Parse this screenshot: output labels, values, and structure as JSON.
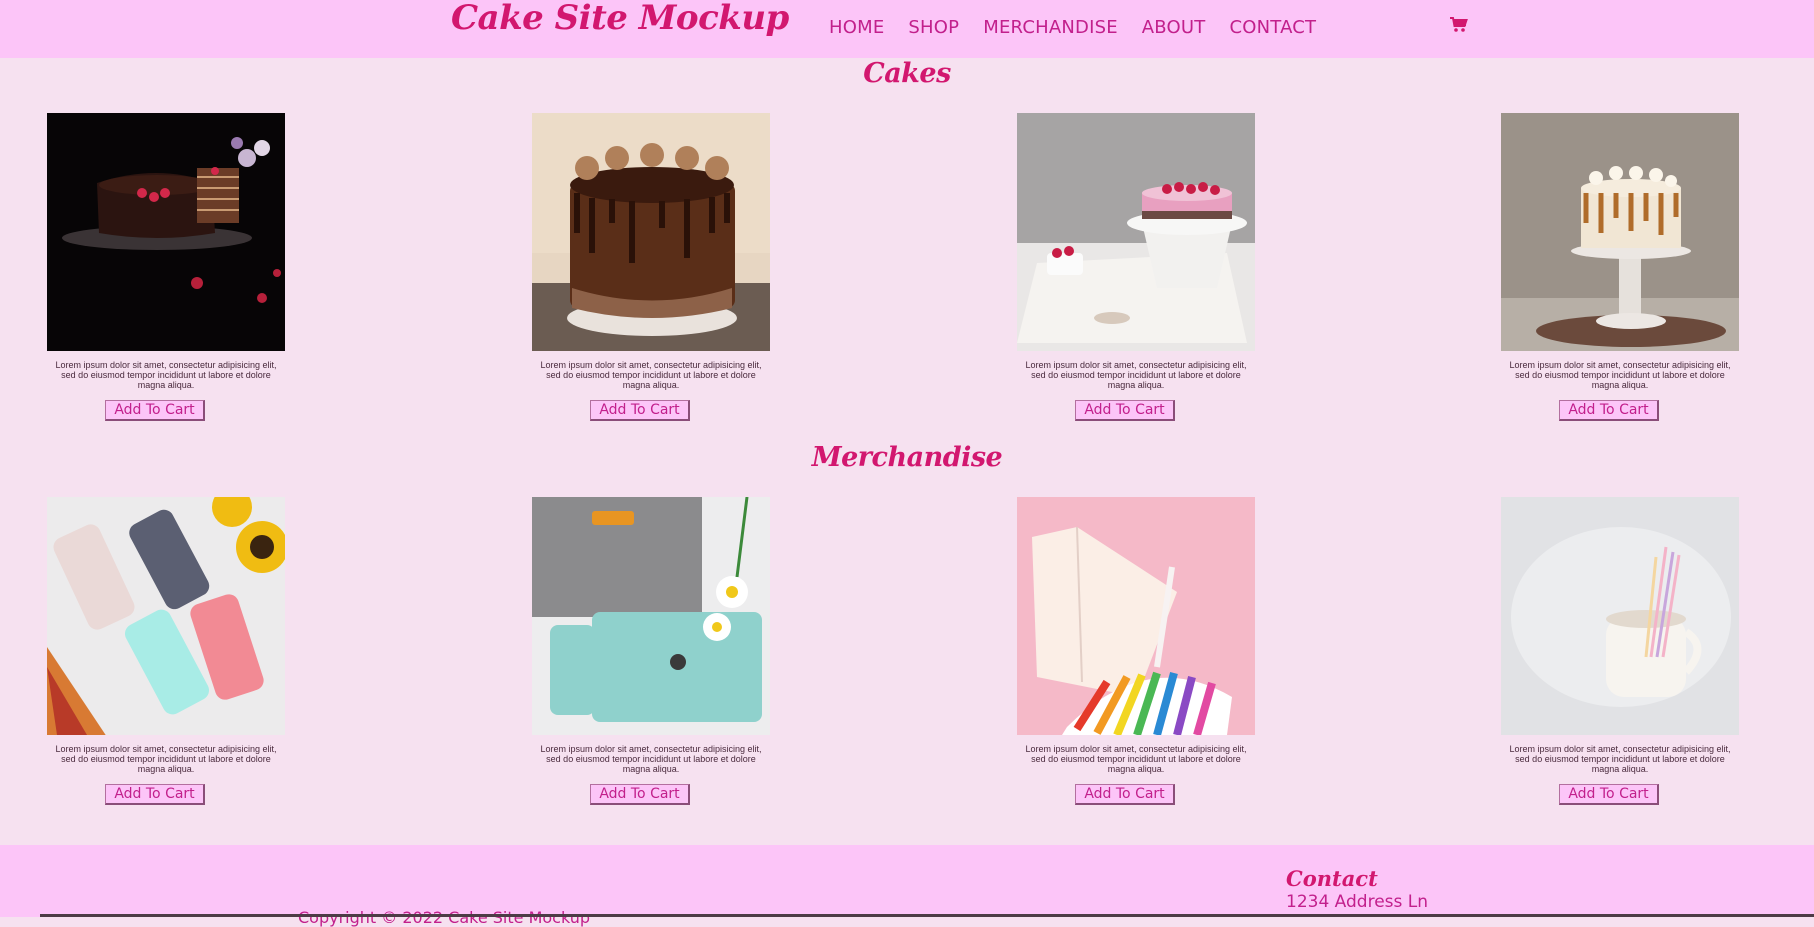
{
  "header": {
    "logo": "Cake Site Mockup",
    "nav": [
      "HOME",
      "SHOP",
      "MERCHANDISE",
      "ABOUT",
      "CONTACT"
    ],
    "cart_icon": "shopping-cart-icon"
  },
  "sections": {
    "cakes": {
      "title": "Cakes",
      "products": [
        {
          "image": "chocolate crepe cake with raspberries on dark background",
          "desc": "Lorem ipsum dolor sit amet, consectetur adipisicing elit, sed do eiusmod tempor incididunt ut labore et dolore magna aliqua.",
          "button": "Add To Cart"
        },
        {
          "image": "chocolate drip cake with piped frosting",
          "desc": "Lorem ipsum dolor sit amet, consectetur adipisicing elit, sed do eiusmod tempor incididunt ut labore et dolore magna aliqua.",
          "button": "Add To Cart"
        },
        {
          "image": "raspberry mousse cake on white stand",
          "desc": "Lorem ipsum dolor sit amet, consectetur adipisicing elit, sed do eiusmod tempor incididunt ut labore et dolore magna aliqua.",
          "button": "Add To Cart"
        },
        {
          "image": "caramel drip cake on cake stand",
          "desc": "Lorem ipsum dolor sit amet, consectetur adipisicing elit, sed do eiusmod tempor incididunt ut labore et dolore magna aliqua.",
          "button": "Add To Cart"
        }
      ]
    },
    "merchandise": {
      "title": "Merchandise",
      "products": [
        {
          "image": "pastel phone cases with sunflowers",
          "desc": "Lorem ipsum dolor sit amet, consectetur adipisicing elit, sed do eiusmod tempor incididunt ut labore et dolore magna aliqua.",
          "button": "Add To Cart"
        },
        {
          "image": "teal laptop and phone case with daisies",
          "desc": "Lorem ipsum dolor sit amet, consectetur adipisicing elit, sed do eiusmod tempor incididunt ut labore et dolore magna aliqua.",
          "button": "Add To Cart"
        },
        {
          "image": "notebook and color swatches on pink",
          "desc": "Lorem ipsum dolor sit amet, consectetur adipisicing elit, sed do eiusmod tempor incididunt ut labore et dolore magna aliqua.",
          "button": "Add To Cart"
        },
        {
          "image": "pastel pencils in white mug",
          "desc": "Lorem ipsum dolor sit amet, consectetur adipisicing elit, sed do eiusmod tempor incididunt ut labore et dolore magna aliqua.",
          "button": "Add To Cart"
        }
      ]
    }
  },
  "footer": {
    "copyright": "Copyright © 2022 Cake Site Mockup",
    "contact_title": "Contact",
    "address": "1234 Address Ln"
  },
  "colors": {
    "header_bg": "#fcc5f8",
    "page_bg": "#f6e1f0",
    "accent": "#d2176f",
    "nav_text": "#c2208c"
  }
}
